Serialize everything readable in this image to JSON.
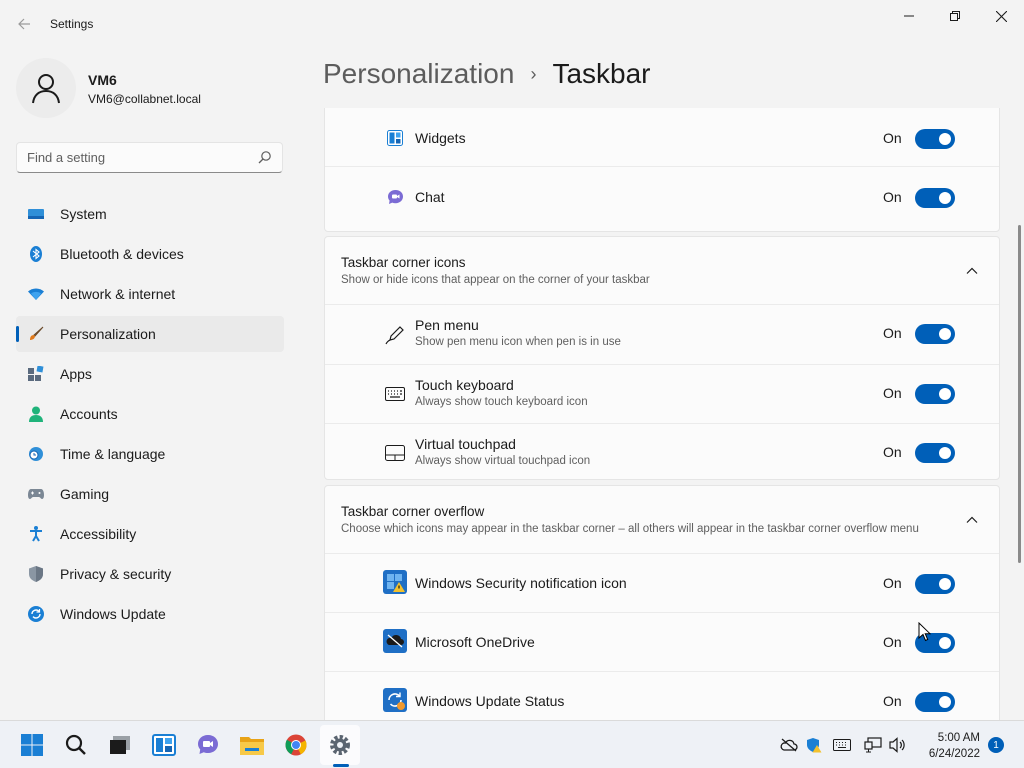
{
  "window": {
    "app_title": "Settings",
    "back_icon": "arrow-left-icon",
    "controls": [
      "minimize",
      "maximize",
      "close"
    ]
  },
  "profile": {
    "name": "VM6",
    "email": "VM6@collabnet.local"
  },
  "search": {
    "placeholder": "Find a setting"
  },
  "nav": {
    "items": [
      {
        "label": "System",
        "icon": "display-icon",
        "selected": false
      },
      {
        "label": "Bluetooth & devices",
        "icon": "bluetooth-icon",
        "selected": false
      },
      {
        "label": "Network & internet",
        "icon": "wifi-icon",
        "selected": false
      },
      {
        "label": "Personalization",
        "icon": "brush-icon",
        "selected": true
      },
      {
        "label": "Apps",
        "icon": "apps-icon",
        "selected": false
      },
      {
        "label": "Accounts",
        "icon": "person-icon",
        "selected": false
      },
      {
        "label": "Time & language",
        "icon": "clock-globe-icon",
        "selected": false
      },
      {
        "label": "Gaming",
        "icon": "gamepad-icon",
        "selected": false
      },
      {
        "label": "Accessibility",
        "icon": "accessibility-icon",
        "selected": false
      },
      {
        "label": "Privacy & security",
        "icon": "shield-icon",
        "selected": false
      },
      {
        "label": "Windows Update",
        "icon": "update-icon",
        "selected": false
      }
    ]
  },
  "header": {
    "parent": "Personalization",
    "separator": "›",
    "current": "Taskbar"
  },
  "taskbar_items": {
    "rows": [
      {
        "title": "Widgets",
        "state": "On",
        "icon": "widgets-icon"
      },
      {
        "title": "Chat",
        "state": "On",
        "icon": "chat-icon"
      }
    ]
  },
  "corner_icons": {
    "title": "Taskbar corner icons",
    "subtitle": "Show or hide icons that appear on the corner of your taskbar",
    "rows": [
      {
        "title": "Pen menu",
        "subtitle": "Show pen menu icon when pen is in use",
        "state": "On",
        "icon": "pen-icon"
      },
      {
        "title": "Touch keyboard",
        "subtitle": "Always show touch keyboard icon",
        "state": "On",
        "icon": "keyboard-icon"
      },
      {
        "title": "Virtual touchpad",
        "subtitle": "Always show virtual touchpad icon",
        "state": "On",
        "icon": "touchpad-icon"
      }
    ]
  },
  "corner_overflow": {
    "title": "Taskbar corner overflow",
    "subtitle": "Choose which icons may appear in the taskbar corner – all others will appear in the taskbar corner overflow menu",
    "rows": [
      {
        "title": "Windows Security notification icon",
        "state": "On",
        "icon": "windows-security-icon"
      },
      {
        "title": "Microsoft OneDrive",
        "state": "On",
        "icon": "onedrive-icon"
      },
      {
        "title": "Windows Update Status",
        "state": "On",
        "icon": "windows-update-status-icon"
      }
    ]
  },
  "taskbar": {
    "apps": [
      "start-icon",
      "search-icon",
      "task-view-icon",
      "widgets-icon",
      "teams-chat-icon",
      "file-explorer-icon",
      "chrome-icon",
      "settings-icon"
    ],
    "tray": [
      "onedrive-offline-icon",
      "security-icon",
      "keyboard-icon",
      "network-icon",
      "volume-icon"
    ],
    "time": "5:00 AM",
    "date": "6/24/2022",
    "notification_count": "1"
  },
  "colors": {
    "accent": "#005fb8",
    "background": "#f3f3f3",
    "card": "#fbfbfb"
  }
}
